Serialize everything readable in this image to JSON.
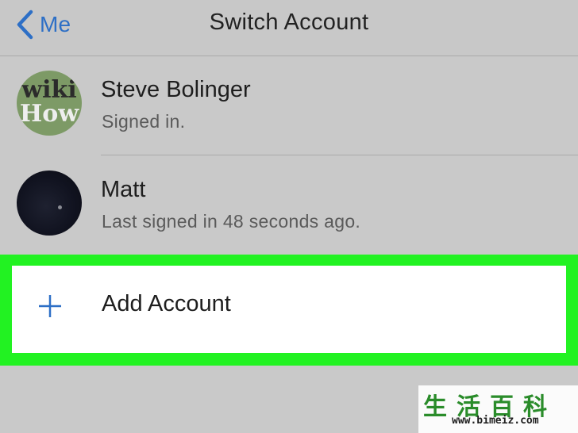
{
  "navbar": {
    "back_label": "Me",
    "title": "Switch Account"
  },
  "accounts": [
    {
      "name": "Steve Bolinger",
      "status": "Signed in.",
      "avatar_text_top": "wiki",
      "avatar_text_bottom": "How"
    },
    {
      "name": "Matt",
      "status": "Last signed in 48 seconds ago."
    }
  ],
  "add_account": {
    "label": "Add Account",
    "highlight_color": "#22f222"
  },
  "watermark": {
    "cjk_text": "生活百科",
    "url": "www.bimeiz.com"
  },
  "colors": {
    "accent": "#2d6fc6",
    "background": "#c9c9c9"
  },
  "icons": {
    "back": "chevron-left-icon",
    "add": "plus-icon"
  }
}
